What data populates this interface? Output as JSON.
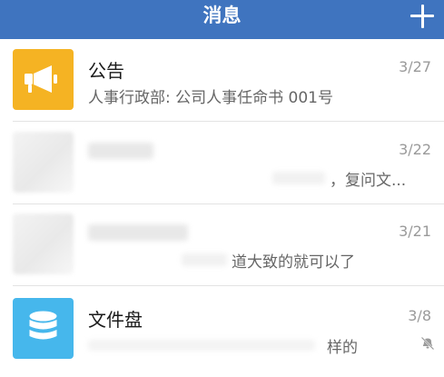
{
  "header": {
    "title": "消息",
    "plus_icon": "plus-icon"
  },
  "messages": [
    {
      "title": "公告",
      "preview": "人事行政部: 公司人事任命书 001号",
      "date": "3/27",
      "avatar_icon": "megaphone-icon",
      "avatar_color": "#f5b323"
    },
    {
      "title": "",
      "preview": "，复问文...",
      "date": "3/22"
    },
    {
      "title": "",
      "preview": "道大致的就可以了",
      "date": "3/21"
    },
    {
      "title": "文件盘",
      "preview": "样的",
      "date": "3/8",
      "avatar_icon": "database-icon",
      "avatar_color": "#46b7ec",
      "status_icon": "mute-icon"
    }
  ],
  "colors": {
    "header_bg": "#3f74bf",
    "title_text": "#1a1a1a",
    "secondary_text": "#666666",
    "date_text": "#9a9a9a"
  }
}
